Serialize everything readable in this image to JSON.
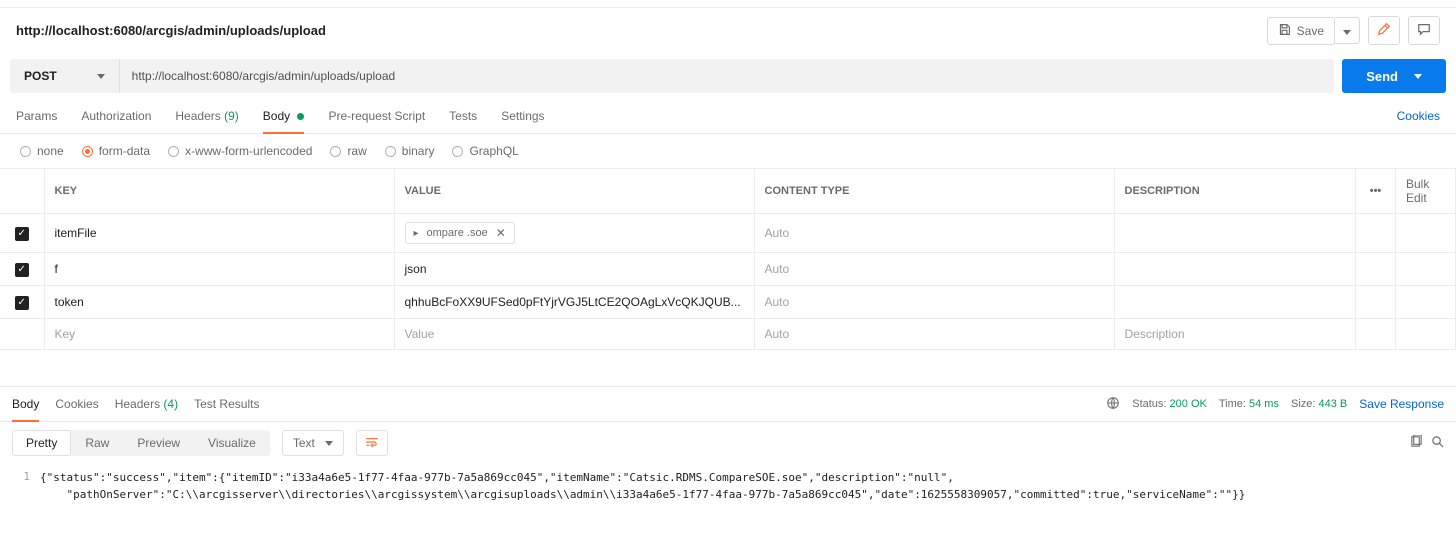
{
  "header": {
    "requestName": "http://localhost:6080/arcgis/admin/uploads/upload",
    "saveLabel": "Save"
  },
  "urlBar": {
    "method": "POST",
    "url": "http://localhost:6080/arcgis/admin/uploads/upload",
    "sendLabel": "Send"
  },
  "reqTabs": {
    "params": "Params",
    "auth": "Authorization",
    "headers": "Headers",
    "headersCount": "(9)",
    "body": "Body",
    "prereq": "Pre-request Script",
    "tests": "Tests",
    "settings": "Settings",
    "cookies": "Cookies"
  },
  "bodyTypes": {
    "none": "none",
    "formdata": "form-data",
    "urlenc": "x-www-form-urlencoded",
    "raw": "raw",
    "binary": "binary",
    "graphql": "GraphQL"
  },
  "kvTable": {
    "headers": {
      "key": "KEY",
      "value": "VALUE",
      "ct": "CONTENT TYPE",
      "desc": "DESCRIPTION",
      "bulk": "Bulk Edit",
      "more": "•••"
    },
    "rows": [
      {
        "key": "itemFile",
        "value_file": "              ompare      .soe",
        "ct": "Auto",
        "desc": ""
      },
      {
        "key": "f",
        "value": "json",
        "ct": "Auto",
        "desc": ""
      },
      {
        "key": "token",
        "value": "qhhuBcFoXX9UFSed0pFtYjrVGJ5LtCE2QOAgLxVcQKJQUB...",
        "ct": "Auto",
        "desc": ""
      }
    ],
    "placeholders": {
      "key": "Key",
      "value": "Value",
      "ct": "Auto",
      "desc": "Description"
    }
  },
  "respTabs": {
    "body": "Body",
    "cookies": "Cookies",
    "headers": "Headers",
    "headersCount": "(4)",
    "testresults": "Test Results"
  },
  "respMeta": {
    "statusLabel": "Status:",
    "statusValue": "200 OK",
    "timeLabel": "Time:",
    "timeValue": "54 ms",
    "sizeLabel": "Size:",
    "sizeValue": "443 B",
    "saveResp": "Save Response"
  },
  "respToolbar": {
    "pretty": "Pretty",
    "raw": "Raw",
    "preview": "Preview",
    "visualize": "Visualize",
    "formatSel": "Text"
  },
  "responseBody": {
    "line1": "{\"status\":\"success\",\"item\":{\"itemID\":\"i33a4a6e5-1f77-4faa-977b-7a5a869cc045\",\"itemName\":\"Catsic.RDMS.CompareSOE.soe\",\"description\":\"null\",",
    "line2": "\"pathOnServer\":\"C:\\\\arcgisserver\\\\directories\\\\arcgissystem\\\\arcgisuploads\\\\admin\\\\i33a4a6e5-1f77-4faa-977b-7a5a869cc045\",\"date\":1625558309057,\"committed\":true,\"serviceName\":\"\"}}"
  }
}
